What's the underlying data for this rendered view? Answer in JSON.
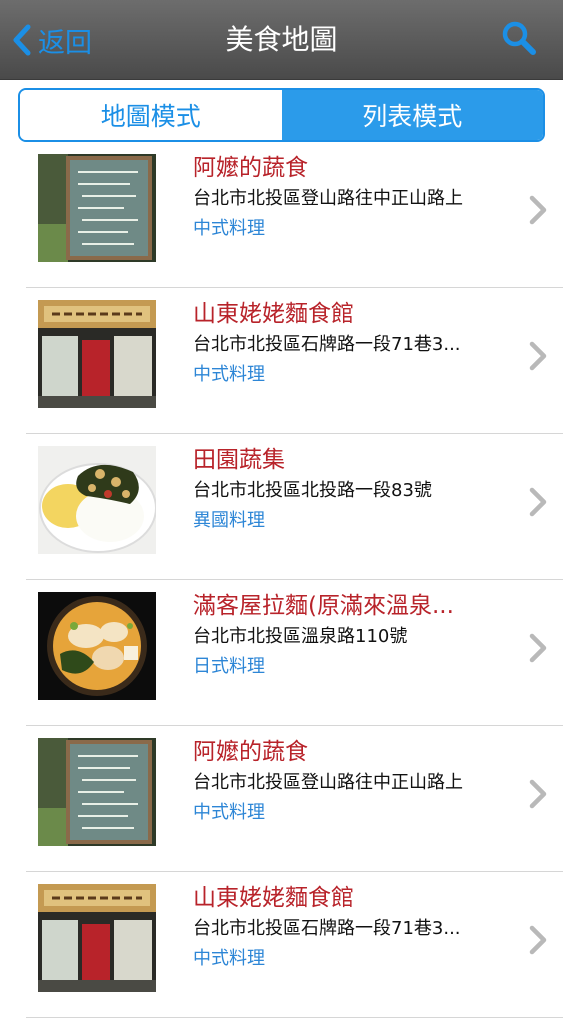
{
  "nav": {
    "back_label": "返回",
    "title": "美食地圖",
    "search_icon": "search-icon"
  },
  "segment": {
    "map_mode": "地圖模式",
    "list_mode": "列表模式",
    "selected": "列表模式"
  },
  "colors": {
    "accent": "#1b8fe6",
    "name": "#b8232a",
    "category": "#2d86d6"
  },
  "list": {
    "items": [
      {
        "name": "阿嬤的蔬食",
        "address": "台北市北投區登山路往中正山路上",
        "category": "中式料理",
        "thumb": "chalkboard-menu"
      },
      {
        "name": "山東姥姥麵食館",
        "address": "台北市北投區石牌路一段71巷3...",
        "category": "中式料理",
        "thumb": "storefront"
      },
      {
        "name": "田園蔬集",
        "address": "台北市北投區北投路一段83號",
        "category": "異國料理",
        "thumb": "rice-dish"
      },
      {
        "name": "滿客屋拉麵(原滿來溫泉...",
        "address": "台北市北投區溫泉路110號",
        "category": "日式料理",
        "thumb": "ramen-bowl"
      },
      {
        "name": "阿嬤的蔬食",
        "address": "台北市北投區登山路往中正山路上",
        "category": "中式料理",
        "thumb": "chalkboard-menu"
      },
      {
        "name": "山東姥姥麵食館",
        "address": "台北市北投區石牌路一段71巷3...",
        "category": "中式料理",
        "thumb": "storefront"
      }
    ]
  }
}
